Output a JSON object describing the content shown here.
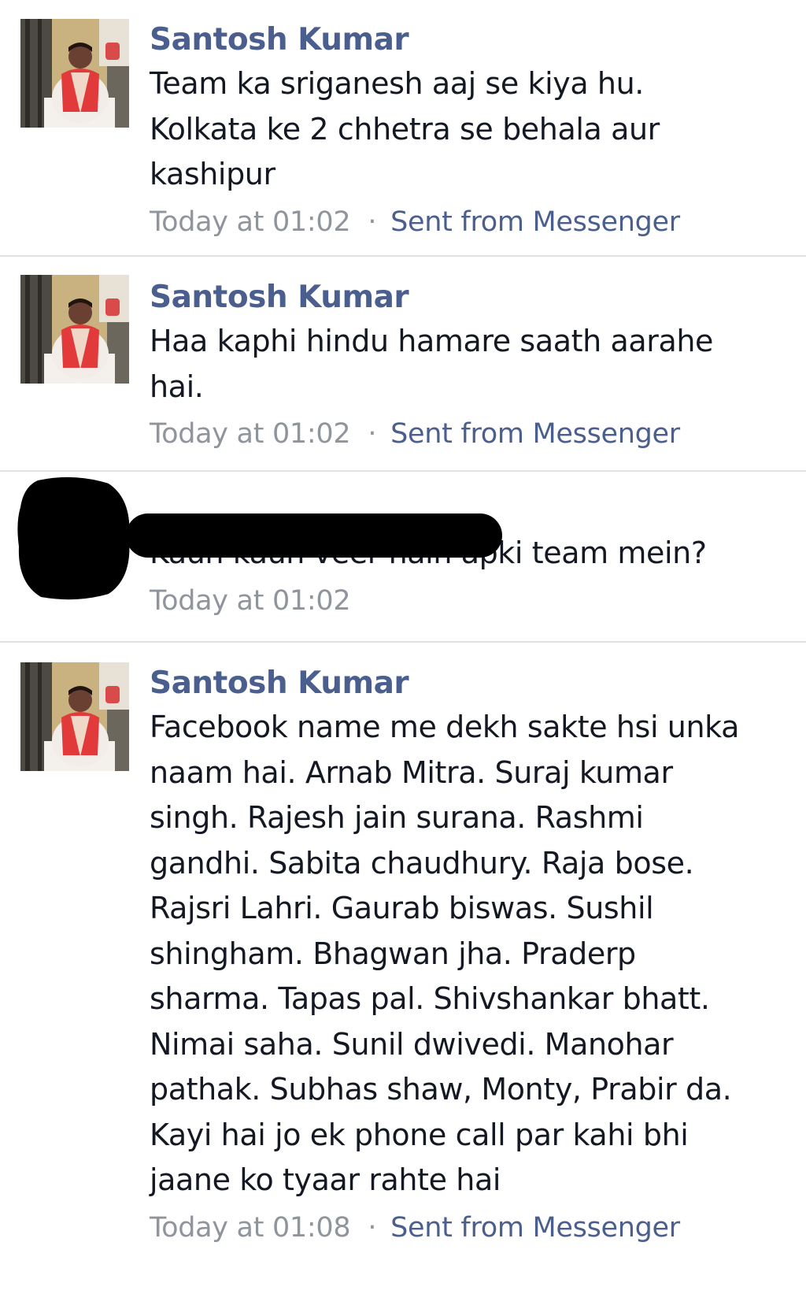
{
  "messages": [
    {
      "sender": "Santosh Kumar",
      "text": "Team ka sriganesh aaj se kiya hu.\nKolkata ke 2 chhetra se behala aur\nkashipur",
      "time": "Today at 01:02",
      "separator": "·",
      "source": "Sent from Messenger"
    },
    {
      "sender": "Santosh Kumar",
      "text": "Haa kaphi hindu hamare saath aarahe\nhai.",
      "time": "Today at 01:02",
      "separator": "·",
      "source": "Sent from Messenger"
    },
    {
      "sender": "",
      "text": "Kaun kaun veer hain apki team mein?",
      "time": "Today at 01:02"
    },
    {
      "sender": "Santosh Kumar",
      "text": "Facebook name me dekh sakte hsi unka\nnaam hai. Arnab Mitra. Suraj kumar\nsingh. Rajesh jain surana. Rashmi\ngandhi. Sabita chaudhury. Raja bose.\nRajsri Lahri. Gaurab biswas. Sushil\nshingham. Bhagwan jha. Praderp\nsharma. Tapas pal. Shivshankar bhatt.\nNimai saha. Sunil dwivedi. Manohar\npathak. Subhas shaw, Monty, Prabir da.\nKayi hai jo ek phone call par kahi bhi\njaane ko tyaar rahte hai",
      "time": "Today at 01:08",
      "separator": "·",
      "source": "Sent from Messenger"
    }
  ],
  "icons": {
    "avatar": "profile-photo",
    "redacted_avatar": "redaction-mark"
  },
  "colors": {
    "sender_name": "#4b5f8f",
    "message_text": "#141823",
    "timestamp": "#90949c",
    "source_link": "#4b5f8f",
    "divider": "#dfe1e5",
    "redaction": "#000000"
  }
}
